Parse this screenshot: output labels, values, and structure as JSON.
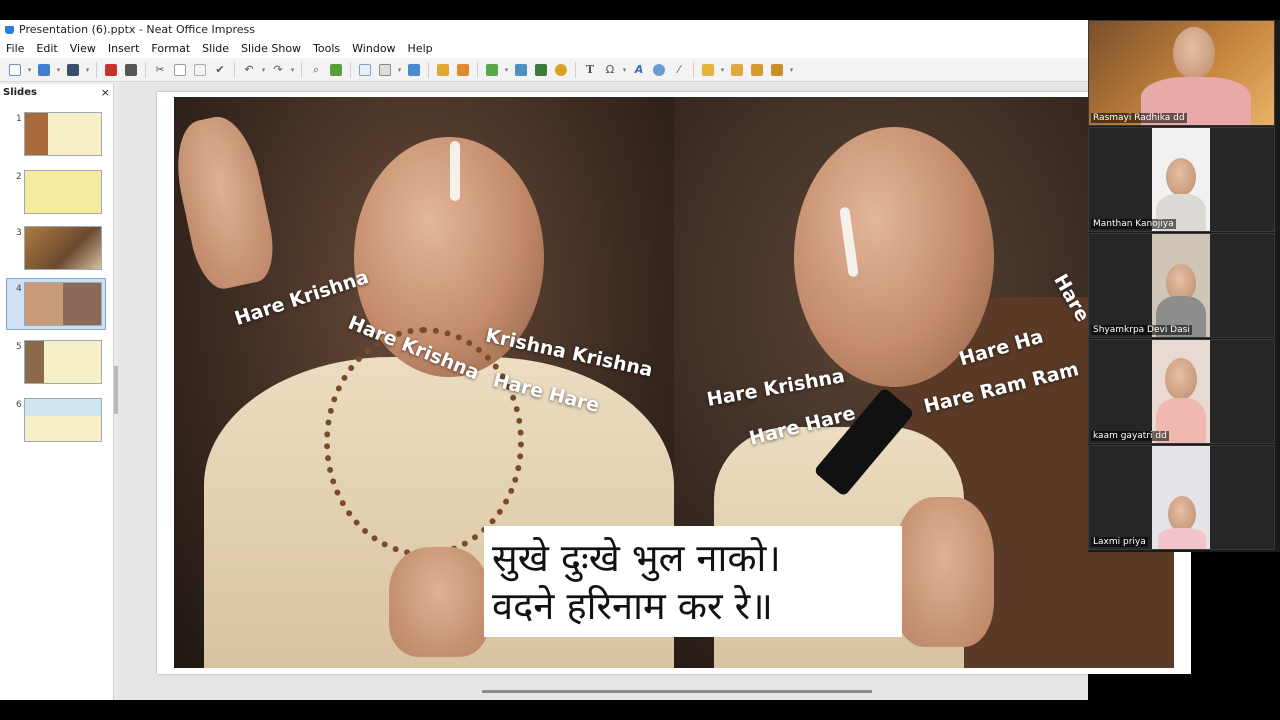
{
  "window": {
    "title": "Presentation (6).pptx - Neat Office Impress"
  },
  "menu": [
    "File",
    "Edit",
    "View",
    "Insert",
    "Format",
    "Slide",
    "Slide Show",
    "Tools",
    "Window",
    "Help"
  ],
  "slides_pane": {
    "title": "Slides",
    "close_label": "×",
    "thumbnails": [
      {
        "number": "1"
      },
      {
        "number": "2"
      },
      {
        "number": "3"
      },
      {
        "number": "4",
        "selected": true
      },
      {
        "number": "5"
      },
      {
        "number": "6"
      }
    ]
  },
  "slide": {
    "chants": {
      "left_1": "Hare Krishna",
      "left_2": "Hare Krishna",
      "left_3": "Krishna Krishna",
      "left_4": "Hare Hare",
      "right_1": "Hare Krishna",
      "right_2": "Hare Hare",
      "right_3": "Hare Ha",
      "right_4": "Hare Ram Ram",
      "right_5": "Hare"
    },
    "caption": {
      "line1": "सुखे दुःखे भुल नाको।",
      "line2": "वदने हरिनाम कर रे॥"
    }
  },
  "participants": [
    {
      "name": "Rasmayi Radhika dd"
    },
    {
      "name": "Manthan Kanojiya"
    },
    {
      "name": "Shyamkrpa Devi Dasi"
    },
    {
      "name": "kaam gayatri dd"
    },
    {
      "name": "Laxmi priya"
    }
  ],
  "colors": {
    "accent": "#2a7fd4",
    "slide_bg": "#ffffff",
    "work_bg": "#e6e6e6"
  }
}
